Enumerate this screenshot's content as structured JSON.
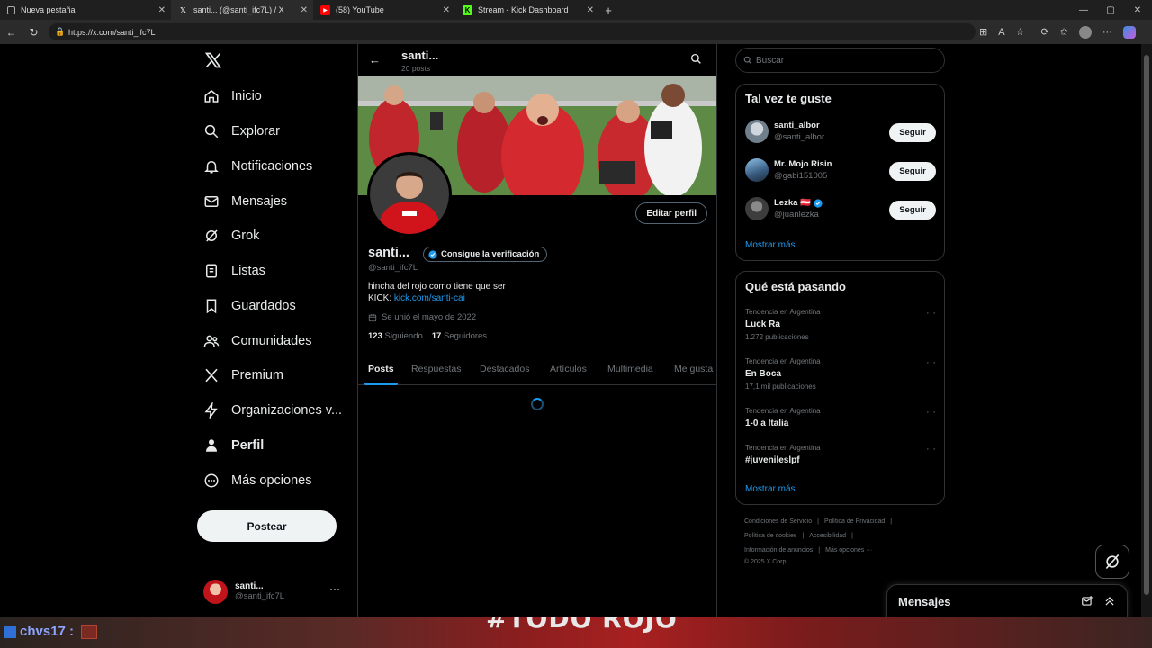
{
  "browser": {
    "tabs": [
      {
        "title": "Nueva pestaña",
        "icon": "page-icon"
      },
      {
        "title": "santi... (@santi_ifc7L) / X",
        "icon": "x-icon"
      },
      {
        "title": "(58) YouTube",
        "icon": "youtube-icon"
      },
      {
        "title": "Stream - Kick Dashboard",
        "icon": "kick-icon"
      }
    ],
    "url": "https://x.com/santi_ifc7L"
  },
  "sidebar": {
    "items": [
      {
        "label": "Inicio",
        "icon": "home-icon"
      },
      {
        "label": "Explorar",
        "icon": "search-icon"
      },
      {
        "label": "Notificaciones",
        "icon": "bell-icon"
      },
      {
        "label": "Mensajes",
        "icon": "mail-icon"
      },
      {
        "label": "Grok",
        "icon": "grok-icon"
      },
      {
        "label": "Listas",
        "icon": "list-icon"
      },
      {
        "label": "Guardados",
        "icon": "bookmark-icon"
      },
      {
        "label": "Comunidades",
        "icon": "people-icon"
      },
      {
        "label": "Premium",
        "icon": "x-icon"
      },
      {
        "label": "Organizaciones v...",
        "icon": "lightning-icon"
      },
      {
        "label": "Perfil",
        "icon": "person-icon"
      },
      {
        "label": "Más opciones",
        "icon": "more-circle-icon"
      }
    ],
    "post_label": "Postear",
    "account": {
      "name": "santi...",
      "handle": "@santi_ifc7L"
    }
  },
  "profile": {
    "header_name": "santi...",
    "post_count": "20 posts",
    "name": "santi...",
    "verify_label": "Consigue la verificación",
    "handle": "@santi_ifc7L",
    "edit_label": "Editar perfil",
    "bio_line1": "hincha del rojo como tiene que ser",
    "bio_kick_prefix": "KICK:",
    "bio_link": "kick.com/santi-cai",
    "joined": "Se unió el mayo de 2022",
    "following_count": "123",
    "following_label": "Siguiendo",
    "followers_count": "17",
    "followers_label": "Seguidores",
    "tabs": [
      "Posts",
      "Respuestas",
      "Destacados",
      "Artículos",
      "Multimedia",
      "Me gusta"
    ],
    "active_tab": "Posts"
  },
  "right": {
    "search_placeholder": "Buscar",
    "suggest_title": "Tal vez te guste",
    "suggestions": [
      {
        "name": "santi_albor",
        "handle": "@santi_albor",
        "button": "Seguir"
      },
      {
        "name": "Mr. Mojo Risin",
        "handle": "@gabi151005",
        "button": "Seguir"
      },
      {
        "name": "Lezka 🇦🇹",
        "handle": "@juanlezka",
        "button": "Seguir",
        "verified": true
      }
    ],
    "show_more": "Mostrar más",
    "trends_title": "Qué está pasando",
    "trends": [
      {
        "context": "Tendencia en Argentina",
        "title": "Luck Ra",
        "count": "1.272 publicaciones"
      },
      {
        "context": "Tendencia en Argentina",
        "title": "En Boca",
        "count": "17,1 mil publicaciones"
      },
      {
        "context": "Tendencia en Argentina",
        "title": "1-0 a Italia",
        "count": ""
      },
      {
        "context": "Tendencia en Argentina",
        "title": "#juvenileslpf",
        "count": ""
      }
    ],
    "trends_more": "Mostrar más",
    "footer1": [
      "Condiciones de Servicio",
      "Política de Privacidad"
    ],
    "footer2": [
      "Política de cookies",
      "Accesibilidad"
    ],
    "footer3": [
      "Información de anuncios",
      "Más opciones ···"
    ],
    "copyright": "© 2025 X Corp."
  },
  "messages": {
    "title": "Mensajes"
  },
  "stream_overlay": {
    "chat_user": "chvs17 :",
    "banner_text": "#TODO ROJO"
  },
  "colors": {
    "accent": "#1d9bf0",
    "bg": "#000000",
    "border": "#2f3336",
    "muted": "#71767b"
  }
}
